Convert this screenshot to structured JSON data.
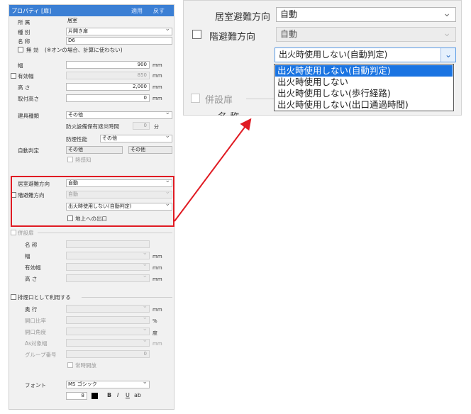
{
  "panel": {
    "title": "プロパティ [扉]",
    "header_buttons": [
      "適用",
      "戻す"
    ],
    "rows": {
      "shozoku": {
        "label": "所 属",
        "value": "居室"
      },
      "shubetsu": {
        "label": "種 別",
        "value": "片開き扉"
      },
      "meisho": {
        "label": "名 称",
        "value": "D6"
      },
      "mukou": {
        "label": "無 効",
        "note": "(※オンの場合、計算に使わない)"
      },
      "haba": {
        "label": "幅",
        "value": "900",
        "unit": "mm"
      },
      "yukohaba": {
        "label": "有効幅",
        "value": "850",
        "unit": "mm"
      },
      "takasa": {
        "label": "高 さ",
        "value": "2,000",
        "unit": "mm"
      },
      "toritsuke": {
        "label": "取付高さ",
        "value": "0",
        "unit": "mm"
      },
      "tategu": {
        "label": "建具種類",
        "value": "その他"
      },
      "bouka": {
        "label": "防火設備保有遮炎時間",
        "value": "0",
        "unit": "分"
      },
      "bouen": {
        "label": "防煙性能",
        "value": "その他"
      },
      "jidou": {
        "label": "自動判定",
        "value1": "その他",
        "value2": "その他",
        "check": "熱感知"
      },
      "kyoshitsu": {
        "label": "居室避難方向",
        "value": "自動"
      },
      "kaihinan": {
        "label": "階避難方向",
        "value": "自動",
        "sub": "出火時使用しない(自動判定)",
        "check": "地上への出口"
      }
    },
    "heisetsu": {
      "group": "併設扉",
      "meisho": "名 称",
      "haba": {
        "label": "幅",
        "unit": "mm"
      },
      "yukohaba": {
        "label": "有効幅",
        "unit": "mm"
      },
      "takasa": {
        "label": "高 さ",
        "unit": "mm"
      }
    },
    "haien": {
      "group": "排煙口として利用する",
      "okuyuki": {
        "label": "奥 行",
        "unit": "mm"
      },
      "kaikouhi": {
        "label": "開口比率",
        "unit": "%"
      },
      "kaikoukaku": {
        "label": "開口角度",
        "unit": "度"
      },
      "as": {
        "label": "As対象幅",
        "unit": "mm"
      },
      "group_no": {
        "label": "グループ番号",
        "value": "0"
      },
      "joji": {
        "label": "常時開放"
      }
    },
    "font": {
      "label": "フォント",
      "value": "MS ゴシック",
      "size": "8",
      "bold": "B",
      "italic": "I",
      "underline": "U",
      "strike": "ab"
    }
  },
  "zoom": {
    "kyoshitsu_label": "居室避難方向",
    "kyoshitsu_value": "自動",
    "kaihinan_label": "階避難方向",
    "kaihinan_value": "自動",
    "sub_value": "出火時使用しない(自動判定)",
    "options": [
      "出火時使用しない(自動判定)",
      "出火時使用しない",
      "出火時使用しない(歩行経路)",
      "出火時使用しない(出口通過時間)"
    ],
    "heisetsu_label": "併設扉",
    "partial_label": "名 称"
  },
  "colors": {
    "header": "#3b7fd4",
    "highlight": "#e01b23",
    "selection": "#1a74e2"
  }
}
